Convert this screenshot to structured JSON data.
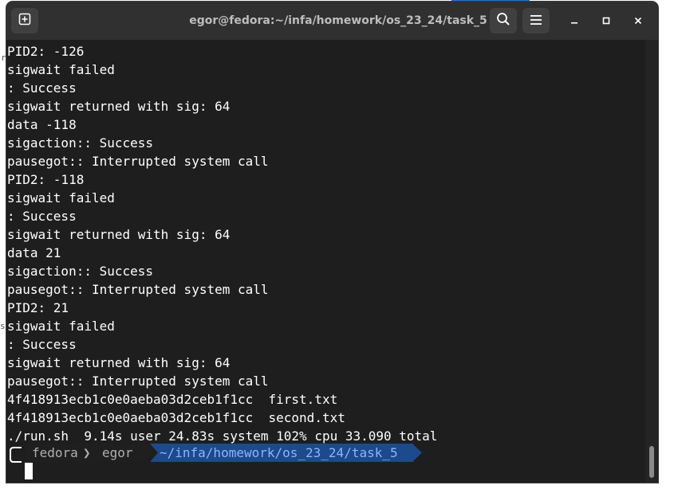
{
  "window": {
    "title": "egor@fedora:~/infa/homework/os_23_24/task_5"
  },
  "titlebar": {
    "new_tab_icon": "new-tab-icon",
    "search_icon": "search-icon",
    "menu_icon": "hamburger-menu-icon",
    "minimize_icon": "minimize-icon",
    "maximize_icon": "maximize-icon",
    "close_icon": "close-icon"
  },
  "terminal": {
    "lines": [
      "PID2: -126",
      "sigwait failed",
      ": Success",
      "sigwait returned with sig: 64",
      "data -118",
      "sigaction:: Success",
      "pausegot:: Interrupted system call",
      "PID2: -118",
      "sigwait failed",
      ": Success",
      "sigwait returned with sig: 64",
      "data 21",
      "sigaction:: Success",
      "pausegot:: Interrupted system call",
      "PID2: 21",
      "sigwait failed",
      ": Success",
      "sigwait returned with sig: 64",
      "pausegot:: Interrupted system call",
      "4f418913ecb1c0e0aeba03d2ceb1f1cc  first.txt",
      "4f418913ecb1c0e0aeba03d2ceb1f1cc  second.txt",
      "./run.sh  9.14s user 24.83s system 102% cpu 33.090 total"
    ],
    "prompt": {
      "host": "fedora",
      "separator": "❯",
      "user": "egor",
      "path": "~/infa/homework/os_23_24/task_5"
    }
  },
  "colors": {
    "terminal_bg": "#1e1e1e",
    "titlebar_bg": "#303030",
    "prompt_host_bg": "#1f1f1f",
    "prompt_path_bg": "#1c4a8a",
    "prompt_path_fg": "#8cb4ff",
    "prompt_user_fg": "#b0b0b0",
    "accent": "#1c71d8"
  },
  "desktop": {
    "edge_glyphs": [
      "r",
      "s"
    ]
  }
}
